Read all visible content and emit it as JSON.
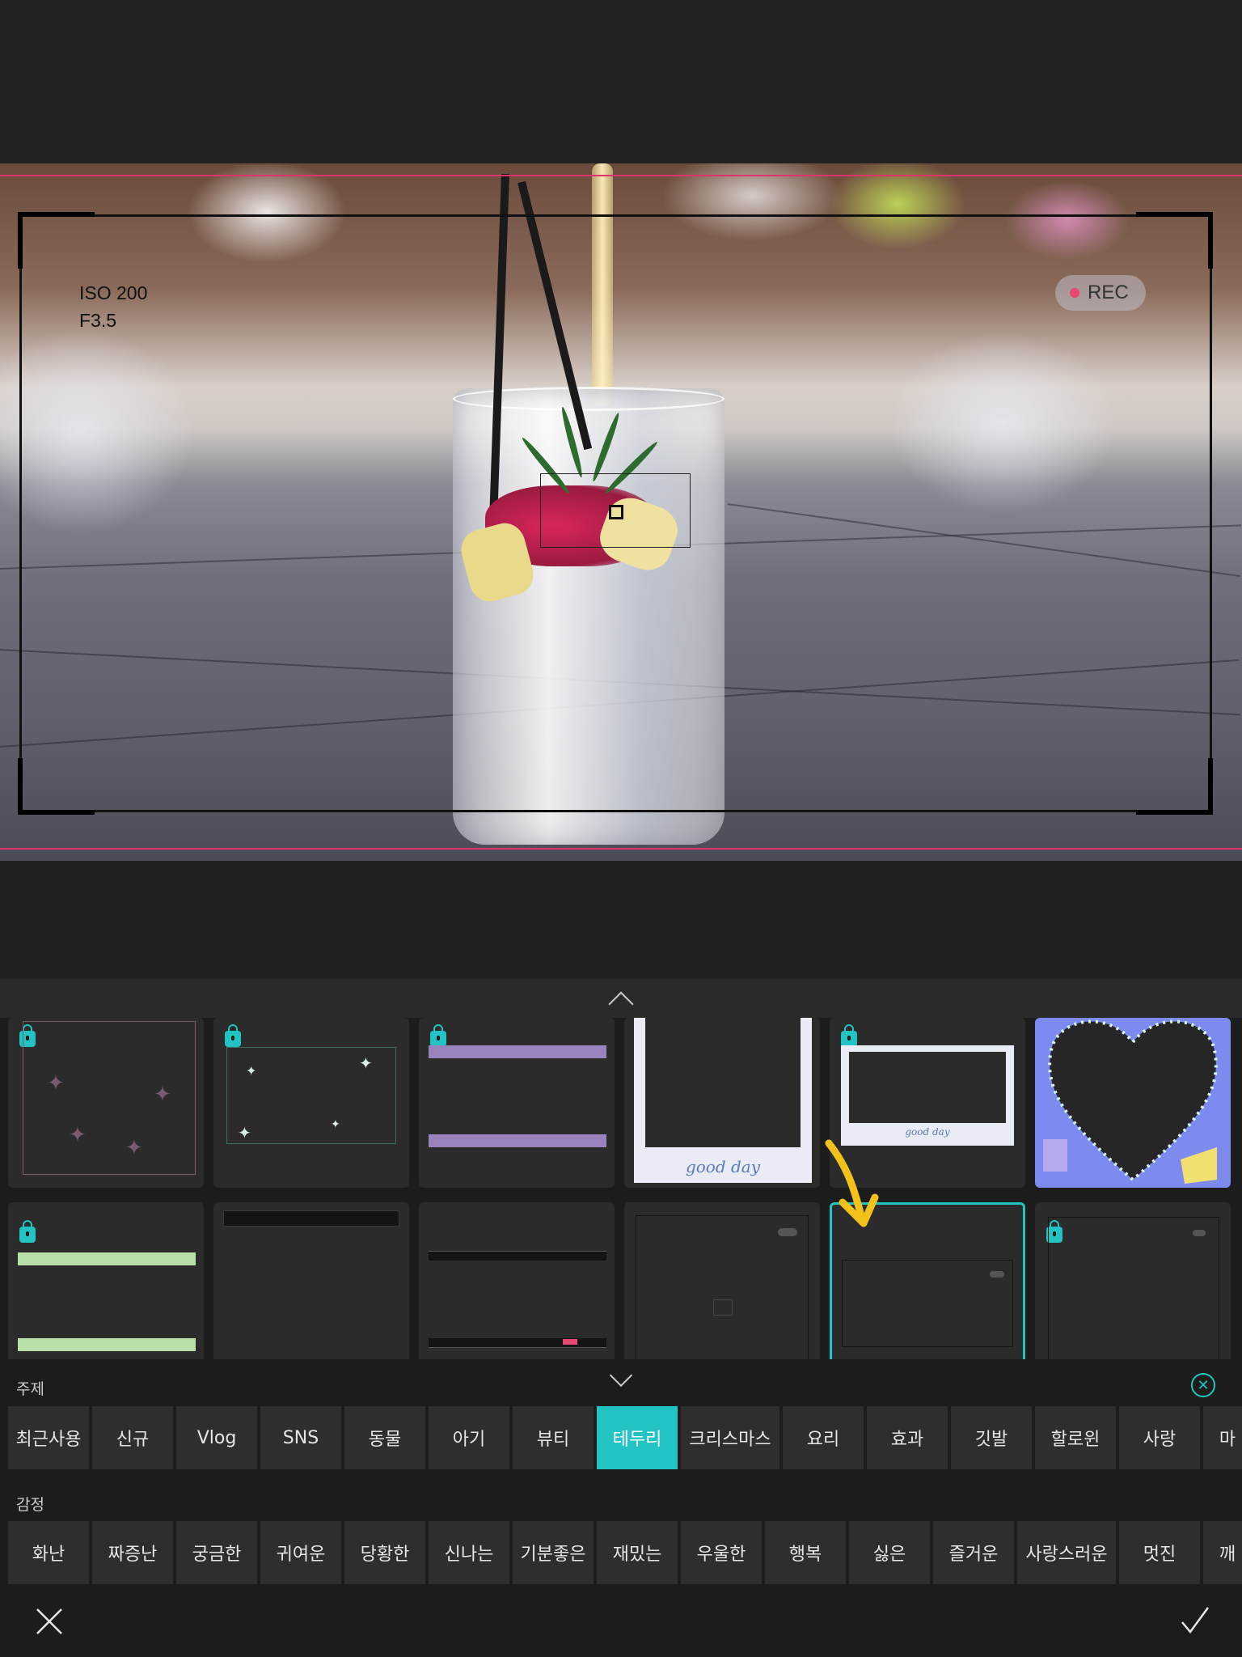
{
  "preview": {
    "overlay": {
      "iso": "ISO 200",
      "aperture": "F3.5",
      "rec": "REC"
    }
  },
  "colors": {
    "accent": "#22c3c3",
    "guide": "#e0336e",
    "rec_dot": "#e54870"
  },
  "panel": {
    "theme_label": "주제",
    "emotion_label": "감정",
    "theme_chips": [
      "최근사용",
      "신규",
      "Vlog",
      "SNS",
      "동물",
      "아기",
      "뷰티",
      "테두리",
      "크리스마스",
      "요리",
      "효과",
      "깃발",
      "할로윈",
      "사랑",
      "마"
    ],
    "emotion_chips": [
      "화난",
      "짜증난",
      "궁금한",
      "귀여운",
      "당황한",
      "신나는",
      "기분좋은",
      "재밌는",
      "우울한",
      "행복",
      "싫은",
      "즐거운",
      "사랑스러운",
      "멋진",
      "깨"
    ],
    "tiles_row1": [
      {
        "icon": "sparkle-frame",
        "locked": true
      },
      {
        "icon": "star-frame",
        "locked": true
      },
      {
        "icon": "purple-band-frame",
        "locked": true
      },
      {
        "icon": "good-day-polaroid",
        "locked": true,
        "caption": "good day"
      },
      {
        "icon": "good-day-grid-frame",
        "locked": true,
        "caption": "good day"
      },
      {
        "icon": "heart-frame",
        "locked": false
      }
    ],
    "tiles_row2": [
      {
        "icon": "green-band-frame",
        "locked": true
      },
      {
        "icon": "black-bar-frame",
        "locked": false
      },
      {
        "icon": "cinema-hud-frame",
        "locked": false
      },
      {
        "icon": "camera-hud-frame",
        "locked": false
      },
      {
        "icon": "camera-hud-frame-small",
        "locked": false,
        "selected": true
      },
      {
        "icon": "viewfinder-frame",
        "locked": true
      }
    ]
  },
  "icons": {
    "expand": "chevron-up-icon",
    "collapse": "chevron-down-icon",
    "clear": "close-circle-icon",
    "cancel": "close-icon",
    "confirm": "check-icon",
    "lock": "lock-icon",
    "annotation": "yellow-arrow-icon"
  }
}
